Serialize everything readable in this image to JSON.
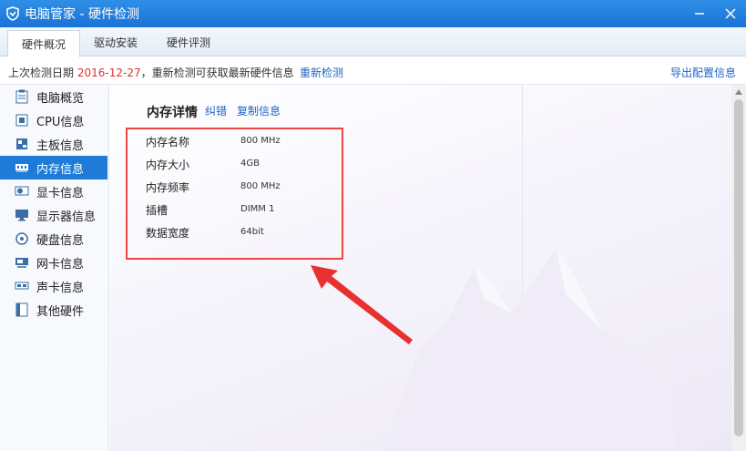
{
  "window": {
    "title": "电脑管家 - 硬件检测"
  },
  "tabs": [
    {
      "label": "硬件概况",
      "active": true
    },
    {
      "label": "驱动安装",
      "active": false
    },
    {
      "label": "硬件评测",
      "active": false
    }
  ],
  "info": {
    "prefix": "上次检测日期",
    "date": "2016-12-27",
    "suffix": "，重新检测可获取最新硬件信息",
    "recheck_label": "重新检测",
    "export_label": "导出配置信息"
  },
  "sidebar": {
    "items": [
      {
        "label": "电脑概览",
        "icon": "clipboard-icon",
        "active": false
      },
      {
        "label": "CPU信息",
        "icon": "cpu-icon",
        "active": false
      },
      {
        "label": "主板信息",
        "icon": "motherboard-icon",
        "active": false
      },
      {
        "label": "内存信息",
        "icon": "memory-icon",
        "active": true
      },
      {
        "label": "显卡信息",
        "icon": "gpu-icon",
        "active": false
      },
      {
        "label": "显示器信息",
        "icon": "monitor-icon",
        "active": false
      },
      {
        "label": "硬盘信息",
        "icon": "disk-icon",
        "active": false
      },
      {
        "label": "网卡信息",
        "icon": "network-card-icon",
        "active": false
      },
      {
        "label": "声卡信息",
        "icon": "sound-card-icon",
        "active": false
      },
      {
        "label": "其他硬件",
        "icon": "other-hardware-icon",
        "active": false
      }
    ]
  },
  "detail": {
    "title": "内存详情",
    "correct_label": "纠错",
    "copy_label": "复制信息",
    "rows": [
      {
        "label": "内存名称",
        "value": "800 MHz"
      },
      {
        "label": "内存大小",
        "value": "4GB"
      },
      {
        "label": "内存频率",
        "value": "800 MHz"
      },
      {
        "label": "插槽",
        "value": "DIMM 1"
      },
      {
        "label": "数据宽度",
        "value": "64bit"
      }
    ]
  },
  "colors": {
    "titlebar": "#1f7bd8",
    "accent": "#1f7bd8",
    "link": "#1b64c8",
    "date": "#e23030",
    "highlight": "#ee4444"
  }
}
